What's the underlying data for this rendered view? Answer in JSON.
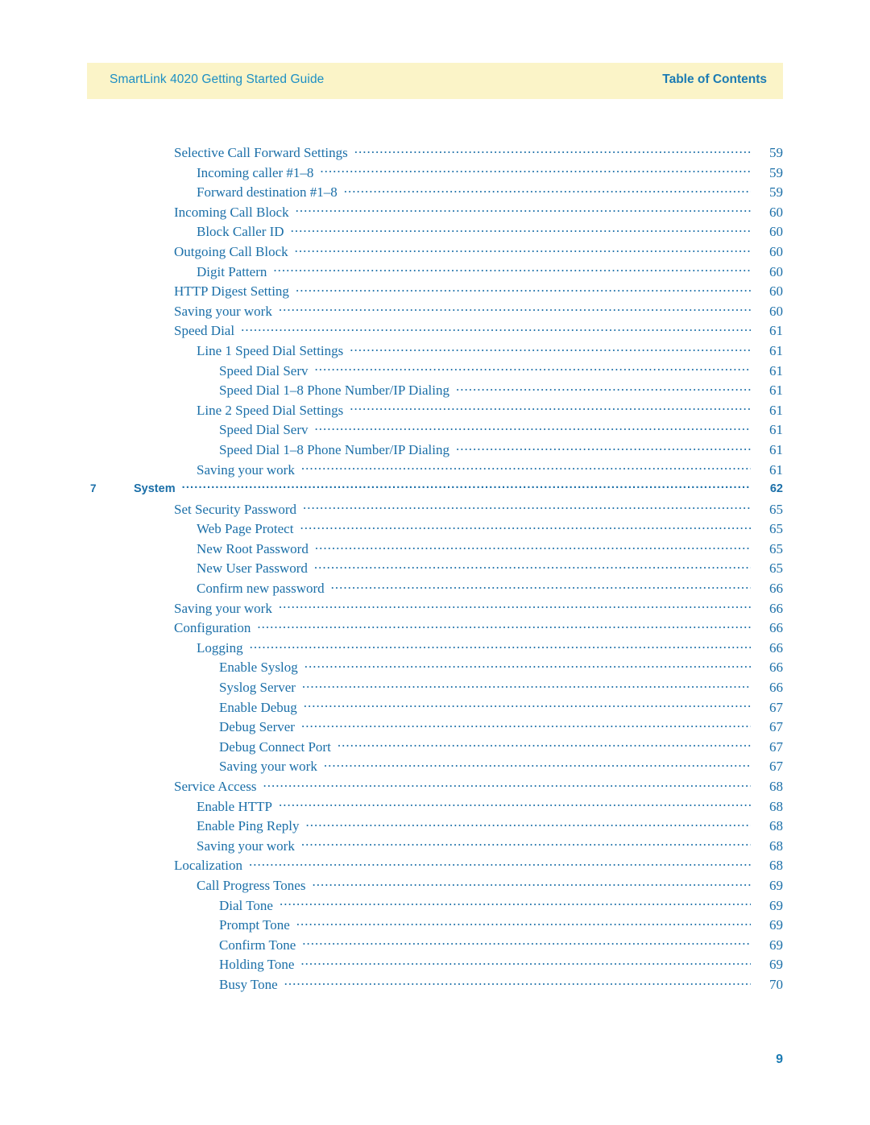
{
  "header": {
    "left_title": "SmartLink 4020 Getting Started Guide",
    "right_title": "Table of Contents"
  },
  "footer": {
    "page_number": "9"
  },
  "toc": {
    "entries": [
      {
        "num": "",
        "label": "Selective Call Forward Settings",
        "page": "59",
        "level": 0,
        "chapter": false
      },
      {
        "num": "",
        "label": "Incoming caller #1–8",
        "page": "59",
        "level": 1,
        "chapter": false
      },
      {
        "num": "",
        "label": "Forward destination #1–8",
        "page": "59",
        "level": 1,
        "chapter": false
      },
      {
        "num": "",
        "label": "Incoming Call Block",
        "page": "60",
        "level": 0,
        "chapter": false
      },
      {
        "num": "",
        "label": "Block Caller ID",
        "page": "60",
        "level": 1,
        "chapter": false
      },
      {
        "num": "",
        "label": "Outgoing Call Block",
        "page": "60",
        "level": 0,
        "chapter": false
      },
      {
        "num": "",
        "label": "Digit Pattern",
        "page": "60",
        "level": 1,
        "chapter": false
      },
      {
        "num": "",
        "label": "HTTP Digest Setting",
        "page": "60",
        "level": 0,
        "chapter": false
      },
      {
        "num": "",
        "label": "Saving your work",
        "page": "60",
        "level": 0,
        "chapter": false
      },
      {
        "num": "",
        "label": "Speed Dial",
        "page": "61",
        "level": 0,
        "chapter": false
      },
      {
        "num": "",
        "label": "Line 1 Speed Dial Settings",
        "page": "61",
        "level": 1,
        "chapter": false
      },
      {
        "num": "",
        "label": "Speed Dial Serv",
        "page": "61",
        "level": 2,
        "chapter": false
      },
      {
        "num": "",
        "label": "Speed Dial 1–8 Phone Number/IP Dialing",
        "page": "61",
        "level": 2,
        "chapter": false
      },
      {
        "num": "",
        "label": "Line 2 Speed Dial Settings",
        "page": "61",
        "level": 1,
        "chapter": false
      },
      {
        "num": "",
        "label": "Speed Dial Serv",
        "page": "61",
        "level": 2,
        "chapter": false
      },
      {
        "num": "",
        "label": "Speed Dial 1–8 Phone Number/IP Dialing",
        "page": "61",
        "level": 2,
        "chapter": false
      },
      {
        "num": "",
        "label": "Saving your work",
        "page": "61",
        "level": 1,
        "chapter": false
      },
      {
        "num": "7",
        "label": "System",
        "page": "62",
        "level": 0,
        "chapter": true
      },
      {
        "num": "",
        "label": "Set Security Password",
        "page": "65",
        "level": 0,
        "chapter": false
      },
      {
        "num": "",
        "label": "Web Page Protect",
        "page": "65",
        "level": 1,
        "chapter": false
      },
      {
        "num": "",
        "label": "New Root Password",
        "page": "65",
        "level": 1,
        "chapter": false
      },
      {
        "num": "",
        "label": "New User Password",
        "page": "65",
        "level": 1,
        "chapter": false
      },
      {
        "num": "",
        "label": "Confirm new password",
        "page": "66",
        "level": 1,
        "chapter": false
      },
      {
        "num": "",
        "label": "Saving your work",
        "page": "66",
        "level": 0,
        "chapter": false
      },
      {
        "num": "",
        "label": "Configuration",
        "page": "66",
        "level": 0,
        "chapter": false
      },
      {
        "num": "",
        "label": "Logging",
        "page": "66",
        "level": 1,
        "chapter": false
      },
      {
        "num": "",
        "label": "Enable Syslog",
        "page": "66",
        "level": 2,
        "chapter": false
      },
      {
        "num": "",
        "label": "Syslog Server",
        "page": "66",
        "level": 2,
        "chapter": false
      },
      {
        "num": "",
        "label": "Enable Debug",
        "page": "67",
        "level": 2,
        "chapter": false
      },
      {
        "num": "",
        "label": "Debug Server",
        "page": "67",
        "level": 2,
        "chapter": false
      },
      {
        "num": "",
        "label": "Debug Connect Port",
        "page": "67",
        "level": 2,
        "chapter": false
      },
      {
        "num": "",
        "label": "Saving your work",
        "page": "67",
        "level": 2,
        "chapter": false
      },
      {
        "num": "",
        "label": "Service Access",
        "page": "68",
        "level": 0,
        "chapter": false
      },
      {
        "num": "",
        "label": "Enable HTTP",
        "page": "68",
        "level": 1,
        "chapter": false
      },
      {
        "num": "",
        "label": "Enable Ping Reply",
        "page": "68",
        "level": 1,
        "chapter": false
      },
      {
        "num": "",
        "label": "Saving your work",
        "page": "68",
        "level": 1,
        "chapter": false
      },
      {
        "num": "",
        "label": "Localization",
        "page": "68",
        "level": 0,
        "chapter": false
      },
      {
        "num": "",
        "label": "Call Progress Tones",
        "page": "69",
        "level": 1,
        "chapter": false
      },
      {
        "num": "",
        "label": "Dial Tone",
        "page": "69",
        "level": 2,
        "chapter": false
      },
      {
        "num": "",
        "label": "Prompt Tone",
        "page": "69",
        "level": 2,
        "chapter": false
      },
      {
        "num": "",
        "label": "Confirm Tone",
        "page": "69",
        "level": 2,
        "chapter": false
      },
      {
        "num": "",
        "label": "Holding Tone",
        "page": "69",
        "level": 2,
        "chapter": false
      },
      {
        "num": "",
        "label": "Busy Tone",
        "page": "70",
        "level": 2,
        "chapter": false
      }
    ]
  }
}
